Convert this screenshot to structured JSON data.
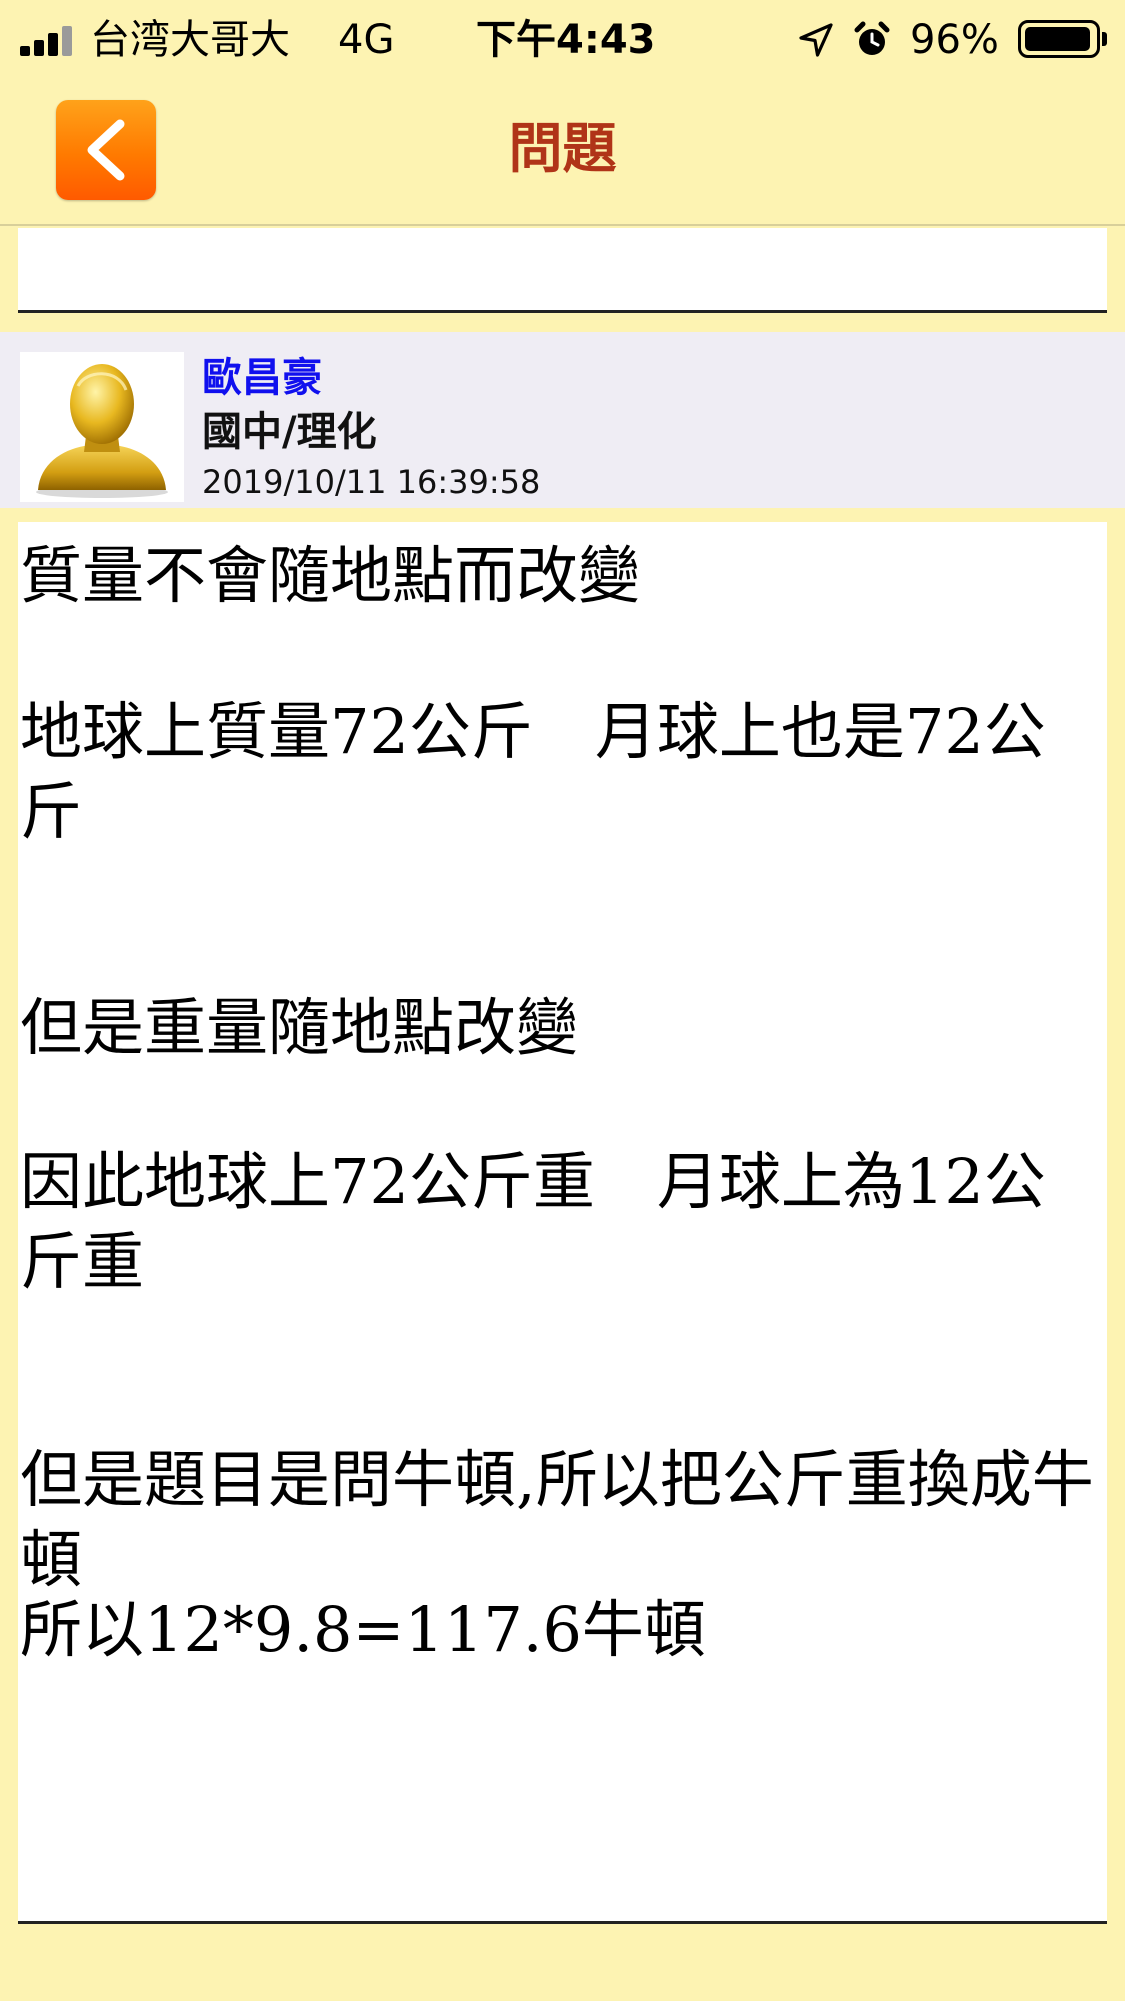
{
  "status_bar": {
    "carrier": "台湾大哥大",
    "network": "4G",
    "time": "下午4:43",
    "battery_percent": "96%",
    "battery_level": 0.96
  },
  "nav": {
    "back_icon": "chevron-left-icon",
    "title": "問題"
  },
  "answer": {
    "author": {
      "name": "歐昌豪",
      "category": "國中/理化",
      "timestamp": "2019/10/11 16:39:58"
    },
    "lines": [
      "質量不會隨地點而改變",
      "地球上質量72公斤　月球上也是72公斤",
      "但是重量隨地點改變",
      "因此地球上72公斤重　月球上為12公斤重",
      "但是題目是問牛頓,所以把公斤重換成牛頓",
      "所以12*9.8=117.6牛頓"
    ]
  },
  "colors": {
    "background": "#fdf3b2",
    "title": "#b03418",
    "author_name": "#1010ee",
    "back_button": "#ff7a00",
    "header_bg": "#efedf4"
  }
}
